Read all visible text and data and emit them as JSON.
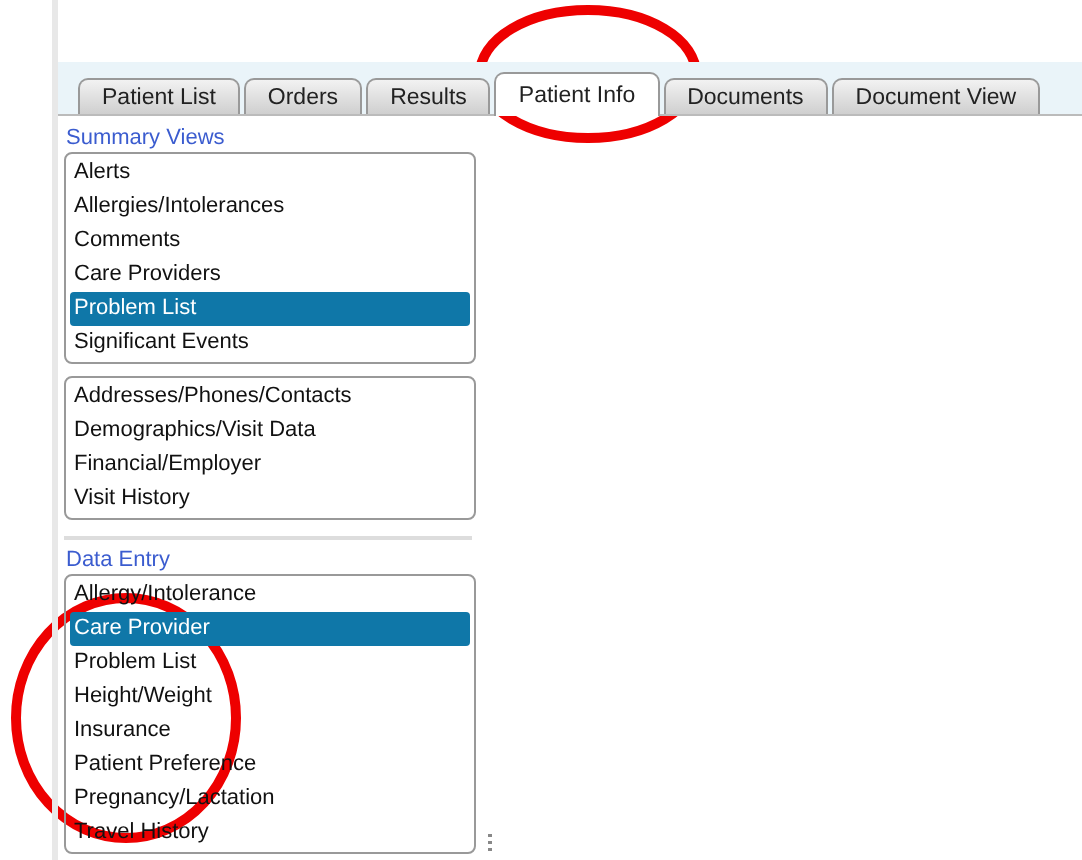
{
  "tabs": [
    {
      "label": "Patient List",
      "selected": false
    },
    {
      "label": "Orders",
      "selected": false
    },
    {
      "label": "Results",
      "selected": false
    },
    {
      "label": "Patient Info",
      "selected": true
    },
    {
      "label": "Documents",
      "selected": false
    },
    {
      "label": "Document View",
      "selected": false
    }
  ],
  "sections": [
    {
      "title": "Summary Views",
      "lists": [
        [
          {
            "label": "Alerts",
            "selected": false
          },
          {
            "label": "Allergies/Intolerances",
            "selected": false
          },
          {
            "label": "Comments",
            "selected": false
          },
          {
            "label": "Care Providers",
            "selected": false
          },
          {
            "label": "Problem List",
            "selected": true
          },
          {
            "label": "Significant Events",
            "selected": false
          }
        ],
        [
          {
            "label": "Addresses/Phones/Contacts",
            "selected": false
          },
          {
            "label": "Demographics/Visit Data",
            "selected": false
          },
          {
            "label": "Financial/Employer",
            "selected": false
          },
          {
            "label": "Visit History",
            "selected": false
          }
        ]
      ]
    },
    {
      "title": "Data Entry",
      "lists": [
        [
          {
            "label": "Allergy/Intolerance",
            "selected": false
          },
          {
            "label": "Care Provider",
            "selected": true
          },
          {
            "label": "Problem List",
            "selected": false
          },
          {
            "label": "Height/Weight",
            "selected": false
          },
          {
            "label": "Insurance",
            "selected": false
          },
          {
            "label": "Patient Preference",
            "selected": false
          },
          {
            "label": "Pregnancy/Lactation",
            "selected": false
          },
          {
            "label": "Travel History",
            "selected": false
          }
        ]
      ]
    }
  ]
}
